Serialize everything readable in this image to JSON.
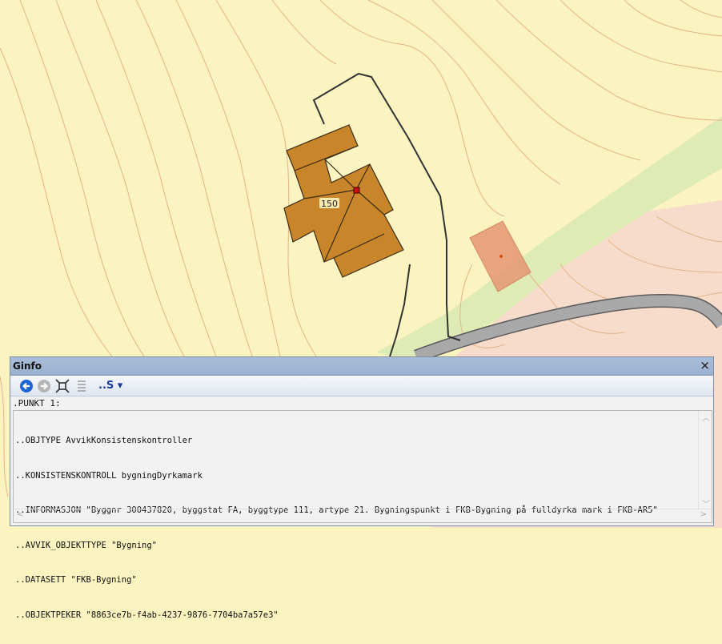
{
  "map": {
    "building_label": "150",
    "colors": {
      "background": "#fbf3c0",
      "contour": "#e0b58c",
      "building_fill": "#c8852a",
      "road": "#a0a0a0",
      "field": "#dfebb4",
      "pink_area": "#f8dccb",
      "marker": "#cc1111"
    }
  },
  "ginfo": {
    "title": "Ginfo",
    "close_label": "×",
    "toolbar": {
      "icons": [
        "back-icon",
        "forward-icon",
        "zoom-to-object-icon",
        "list-icon",
        "select-dropdown-icon"
      ],
      "dropdown_label": "..S ▾"
    },
    "punkt_label": ".PUNKT 1:",
    "lines": [
      "..OBJTYPE AvvikKonsistenskontroller",
      "..KONSISTENSKONTROLL bygningDyrkamark",
      "..INFORMASJON \"Byggnr 300437820, byggstat FA, byggtype 111, artype 21. Bygningspunkt i FKB-Bygning på fulldyrka mark i FKB-AR5\"",
      "..AVVIK_OBJEKTTYPE \"Bygning\"",
      "..DATASETT \"FKB-Bygning\"",
      "..OBJEKTPEKER \"8863ce7b-f4ab-4237-9876-7704ba7a57e3\""
    ]
  }
}
